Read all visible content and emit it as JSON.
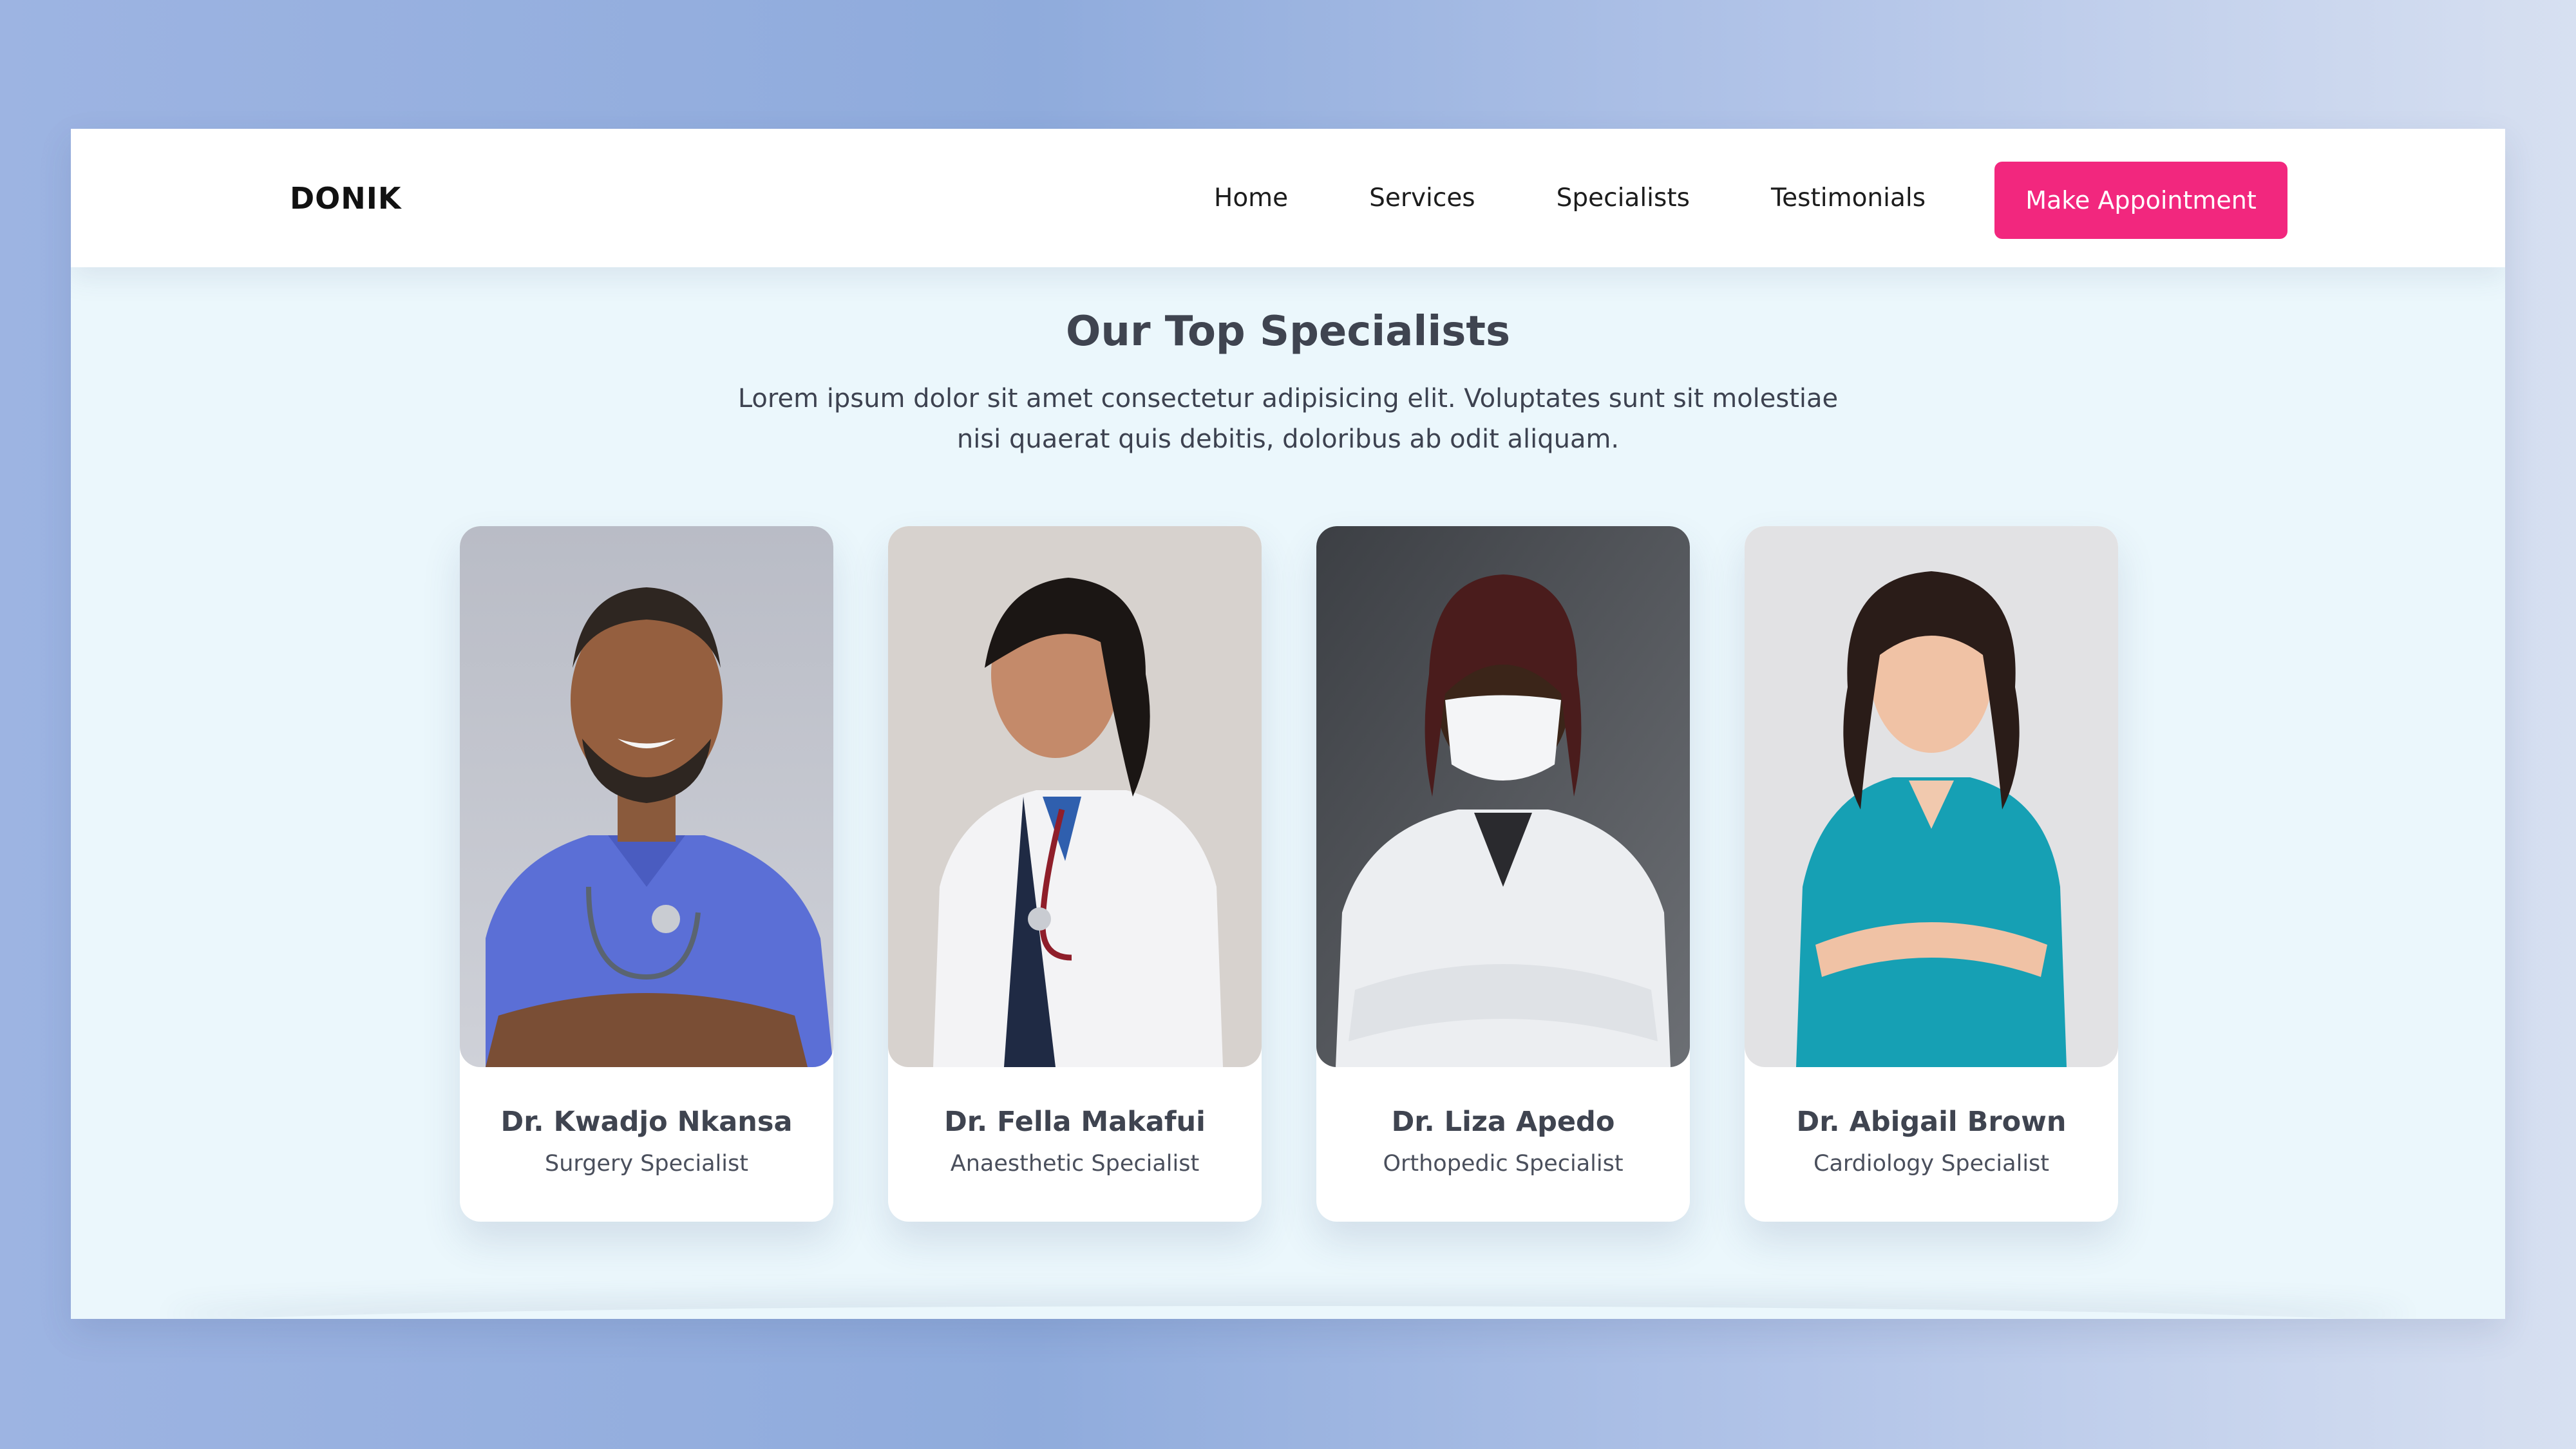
{
  "brand": "DONIK",
  "nav": {
    "items": [
      {
        "label": "Home"
      },
      {
        "label": "Services"
      },
      {
        "label": "Specialists"
      },
      {
        "label": "Testimonials"
      }
    ],
    "cta_label": "Make Appointment"
  },
  "section": {
    "title": "Our Top Specialists",
    "description": "Lorem ipsum dolor sit amet consectetur adipisicing elit. Voluptates sunt sit molestiae nisi quaerat quis debitis, doloribus ab odit aliquam."
  },
  "specialists": [
    {
      "name": "Dr. Kwadjo Nkansa",
      "role": "Surgery Specialist"
    },
    {
      "name": "Dr. Fella Makafui",
      "role": "Anaesthetic Specialist"
    },
    {
      "name": "Dr. Liza Apedo",
      "role": "Orthopedic Specialist"
    },
    {
      "name": "Dr. Abigail Brown",
      "role": "Cardiology Specialist"
    }
  ],
  "colors": {
    "accent": "#f2277e",
    "section_bg": "#ebf7fc",
    "heading": "#3f4450"
  }
}
